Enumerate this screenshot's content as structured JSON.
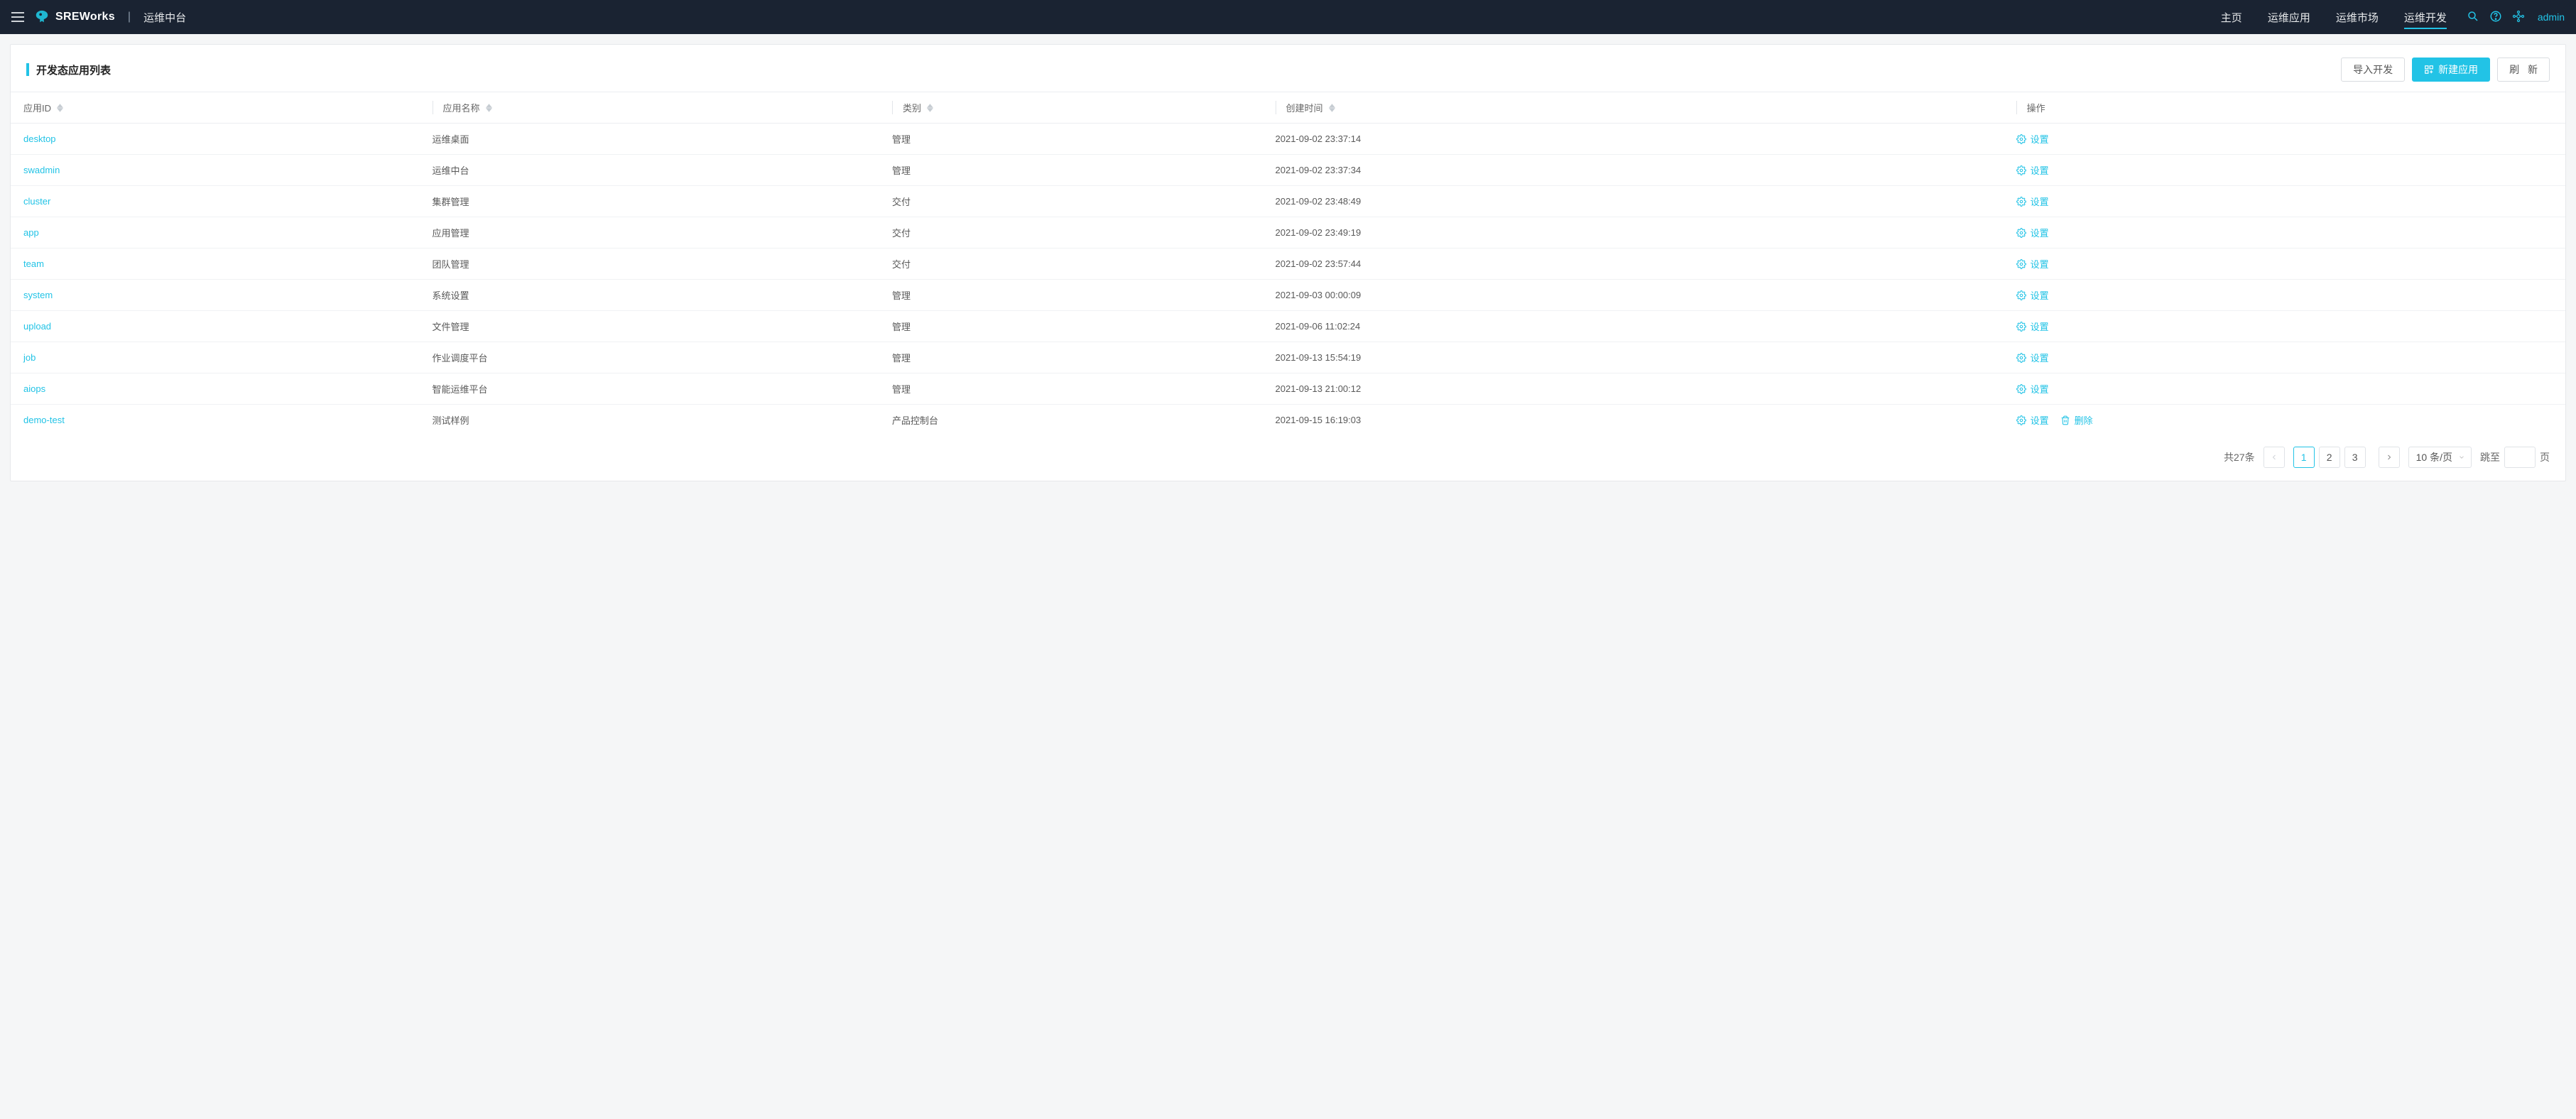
{
  "header": {
    "brand": "SREWorks",
    "subtitle": "运维中台",
    "nav": [
      {
        "label": "主页",
        "active": false
      },
      {
        "label": "运维应用",
        "active": false
      },
      {
        "label": "运维市场",
        "active": false
      },
      {
        "label": "运维开发",
        "active": true
      }
    ],
    "user": "admin"
  },
  "page": {
    "title": "开发态应用列表",
    "actions": {
      "import": "导入开发",
      "create": "新建应用",
      "refresh": "刷 新"
    }
  },
  "table": {
    "columns": {
      "id": "应用ID",
      "name": "应用名称",
      "category": "类别",
      "created": "创建时间",
      "ops": "操作"
    },
    "op_labels": {
      "settings": "设置",
      "delete": "删除"
    },
    "rows": [
      {
        "id": "desktop",
        "name": "运维桌面",
        "category": "管理",
        "created": "2021-09-02 23:37:14",
        "deletable": false
      },
      {
        "id": "swadmin",
        "name": "运维中台",
        "category": "管理",
        "created": "2021-09-02 23:37:34",
        "deletable": false
      },
      {
        "id": "cluster",
        "name": "集群管理",
        "category": "交付",
        "created": "2021-09-02 23:48:49",
        "deletable": false
      },
      {
        "id": "app",
        "name": "应用管理",
        "category": "交付",
        "created": "2021-09-02 23:49:19",
        "deletable": false
      },
      {
        "id": "team",
        "name": "团队管理",
        "category": "交付",
        "created": "2021-09-02 23:57:44",
        "deletable": false
      },
      {
        "id": "system",
        "name": "系统设置",
        "category": "管理",
        "created": "2021-09-03 00:00:09",
        "deletable": false
      },
      {
        "id": "upload",
        "name": "文件管理",
        "category": "管理",
        "created": "2021-09-06 11:02:24",
        "deletable": false
      },
      {
        "id": "job",
        "name": "作业调度平台",
        "category": "管理",
        "created": "2021-09-13 15:54:19",
        "deletable": false
      },
      {
        "id": "aiops",
        "name": "智能运维平台",
        "category": "管理",
        "created": "2021-09-13 21:00:12",
        "deletable": false
      },
      {
        "id": "demo-test",
        "name": "测试样例",
        "category": "产品控制台",
        "created": "2021-09-15 16:19:03",
        "deletable": true
      }
    ]
  },
  "pagination": {
    "total_text": "共27条",
    "pages": [
      "1",
      "2",
      "3"
    ],
    "current": "1",
    "page_size_label": "10 条/页",
    "jump_label": "跳至",
    "jump_suffix": "页"
  }
}
